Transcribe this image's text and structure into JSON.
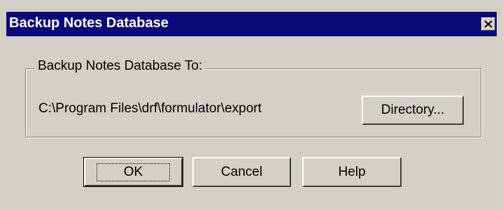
{
  "window": {
    "title": "Backup Notes Database",
    "close_glyph": "✕"
  },
  "group": {
    "label": "Backup Notes Database To:",
    "path": "C:\\Program Files\\drf\\formulator\\export",
    "directory_button": "Directory..."
  },
  "buttons": {
    "ok": "OK",
    "cancel": "Cancel",
    "help": "Help"
  },
  "colors": {
    "titlebar": "#0a0a7a",
    "face": "#d4d0c8"
  }
}
